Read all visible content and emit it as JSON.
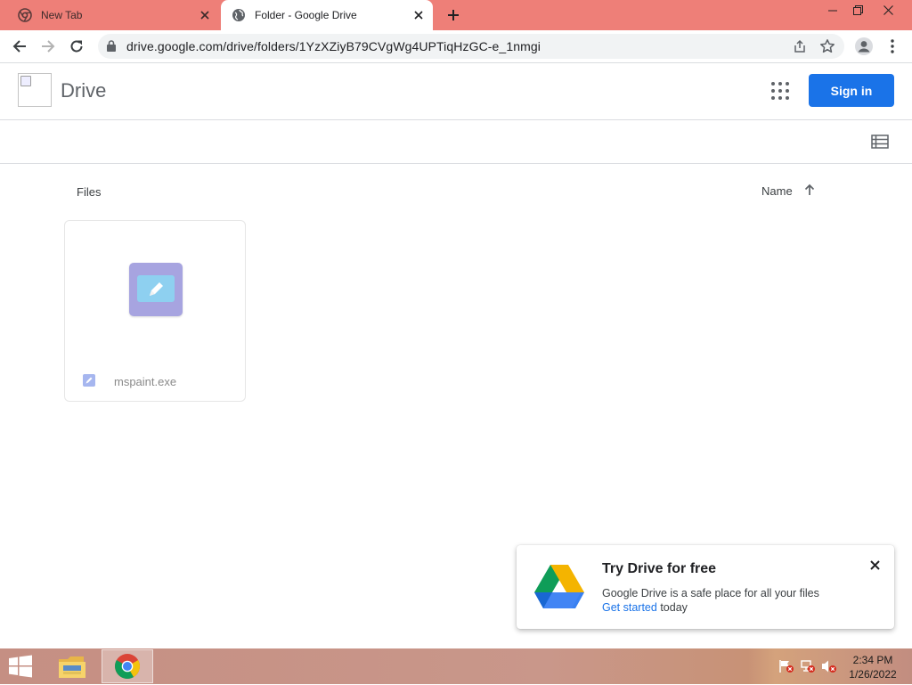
{
  "browser": {
    "tabs": [
      {
        "title": "New Tab",
        "active": false,
        "icon": "chrome-icon"
      },
      {
        "title": "Folder - Google Drive",
        "active": true,
        "icon": "globe-icon"
      }
    ],
    "url": "drive.google.com/drive/folders/1YzXZiyB79CVgWg4UPTiqHzGC-e_1nmgi",
    "accent_tab_strip": "#ee7f78"
  },
  "drive": {
    "title": "Drive",
    "sign_in_label": "Sign in",
    "sign_in_color": "#1a73e8",
    "files_label": "Files",
    "sort_label": "Name",
    "files": [
      {
        "name": "mspaint.exe",
        "icon": "paint-file-icon"
      }
    ]
  },
  "promo": {
    "title": "Try Drive for free",
    "line1": "Google Drive is a safe place for all your files",
    "link_text": "Get started",
    "link_suffix": " today"
  },
  "taskbar": {
    "time": "2:34 PM",
    "date": "1/26/2022",
    "pinned": [
      "start-button",
      "file-explorer",
      "chrome"
    ]
  }
}
